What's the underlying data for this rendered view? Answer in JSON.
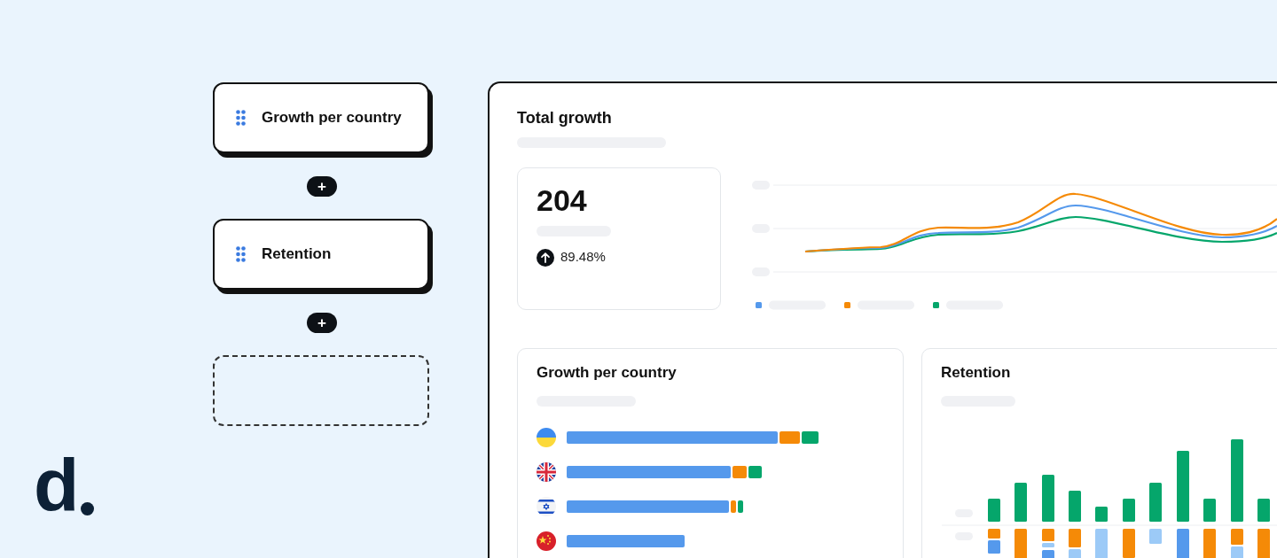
{
  "logo": {
    "text": "d"
  },
  "widget_list": [
    {
      "title": "Growth per country"
    },
    {
      "title": "Retention"
    }
  ],
  "add_buttons": [
    "+",
    "+"
  ],
  "dashboard": {
    "title": "Total growth",
    "kpi": {
      "value": "204",
      "change": "89.48%"
    },
    "cards": [
      {
        "kind": "countries",
        "title": "Growth per country"
      },
      {
        "kind": "retention",
        "title": "Retention"
      }
    ]
  }
}
